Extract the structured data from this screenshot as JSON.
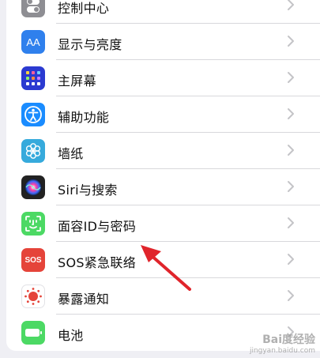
{
  "settings": {
    "items": [
      {
        "label": "控制中心",
        "icon": "control-center-icon",
        "color": "#8e8e93"
      },
      {
        "label": "显示与亮度",
        "icon": "display-brightness-icon",
        "color": "#2f80ed",
        "glyph": "AA"
      },
      {
        "label": "主屏幕",
        "icon": "home-screen-icon",
        "color": "#2b3ad1"
      },
      {
        "label": "辅助功能",
        "icon": "accessibility-icon",
        "color": "#1a8cff"
      },
      {
        "label": "墙纸",
        "icon": "wallpaper-icon",
        "color": "#36aadc"
      },
      {
        "label": "Siri与搜索",
        "icon": "siri-icon",
        "color": "#222222"
      },
      {
        "label": "面容ID与密码",
        "icon": "face-id-icon",
        "color": "#4cd964"
      },
      {
        "label": "SOS紧急联络",
        "icon": "sos-icon",
        "color": "#e5443a",
        "glyph": "SOS"
      },
      {
        "label": "暴露通知",
        "icon": "exposure-notification-icon",
        "color": "#ffffff"
      },
      {
        "label": "电池",
        "icon": "battery-icon",
        "color": "#4cd964"
      }
    ]
  },
  "watermark": {
    "brand": "Bai度经验",
    "url": "jingyan.baidu.com"
  },
  "colors": {
    "accent_arrow": "#e0242b"
  }
}
